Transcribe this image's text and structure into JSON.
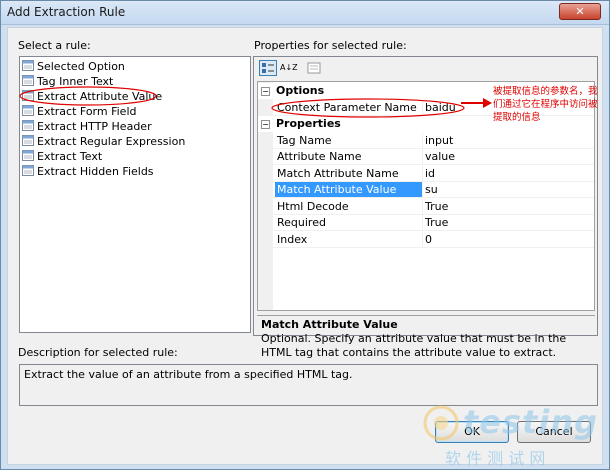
{
  "window": {
    "title": "Add Extraction Rule",
    "close_symbol": "✕"
  },
  "left": {
    "select_label": "Select a rule:",
    "rules": [
      "Selected Option",
      "Tag Inner Text",
      "Extract Attribute Value",
      "Extract Form Field",
      "Extract HTTP Header",
      "Extract Regular Expression",
      "Extract Text",
      "Extract Hidden Fields"
    ],
    "selected_index": 2
  },
  "right": {
    "properties_label": "Properties for selected rule:",
    "toolbar": [
      "categorized-view-icon",
      "alphabetical-sort-icon",
      "property-pages-icon"
    ],
    "sort_label": "A↓Z",
    "categories": [
      {
        "name": "Options",
        "rows": [
          {
            "name": "Context Parameter Name",
            "value": "baidu"
          }
        ]
      },
      {
        "name": "Properties",
        "rows": [
          {
            "name": "Tag Name",
            "value": "input"
          },
          {
            "name": "Attribute Name",
            "value": "value"
          },
          {
            "name": "Match Attribute Name",
            "value": "id"
          },
          {
            "name": "Match Attribute Value",
            "value": "su"
          },
          {
            "name": "Html Decode",
            "value": "True"
          },
          {
            "name": "Required",
            "value": "True"
          },
          {
            "name": "Index",
            "value": "0"
          }
        ]
      }
    ],
    "selected_property": "Match Attribute Value",
    "help_title": "Match Attribute Value",
    "help_text": "Optional. Specify an attribute value that must be in the HTML tag that contains the attribute value to extract."
  },
  "description": {
    "label": "Description for selected rule:",
    "text": "Extract the value of an attribute from a specified HTML tag."
  },
  "buttons": {
    "ok": "OK",
    "cancel": "Cancel"
  },
  "annotation": {
    "text": "被提取信息的参数名，我们通过它在程序中访问被提取的信息",
    "color": "#e00000"
  },
  "watermark": {
    "logo": "testing",
    "caption": "软 件 测 试 网"
  },
  "colors": {
    "selection": "#3399ff",
    "annotation_red": "#e00000"
  }
}
